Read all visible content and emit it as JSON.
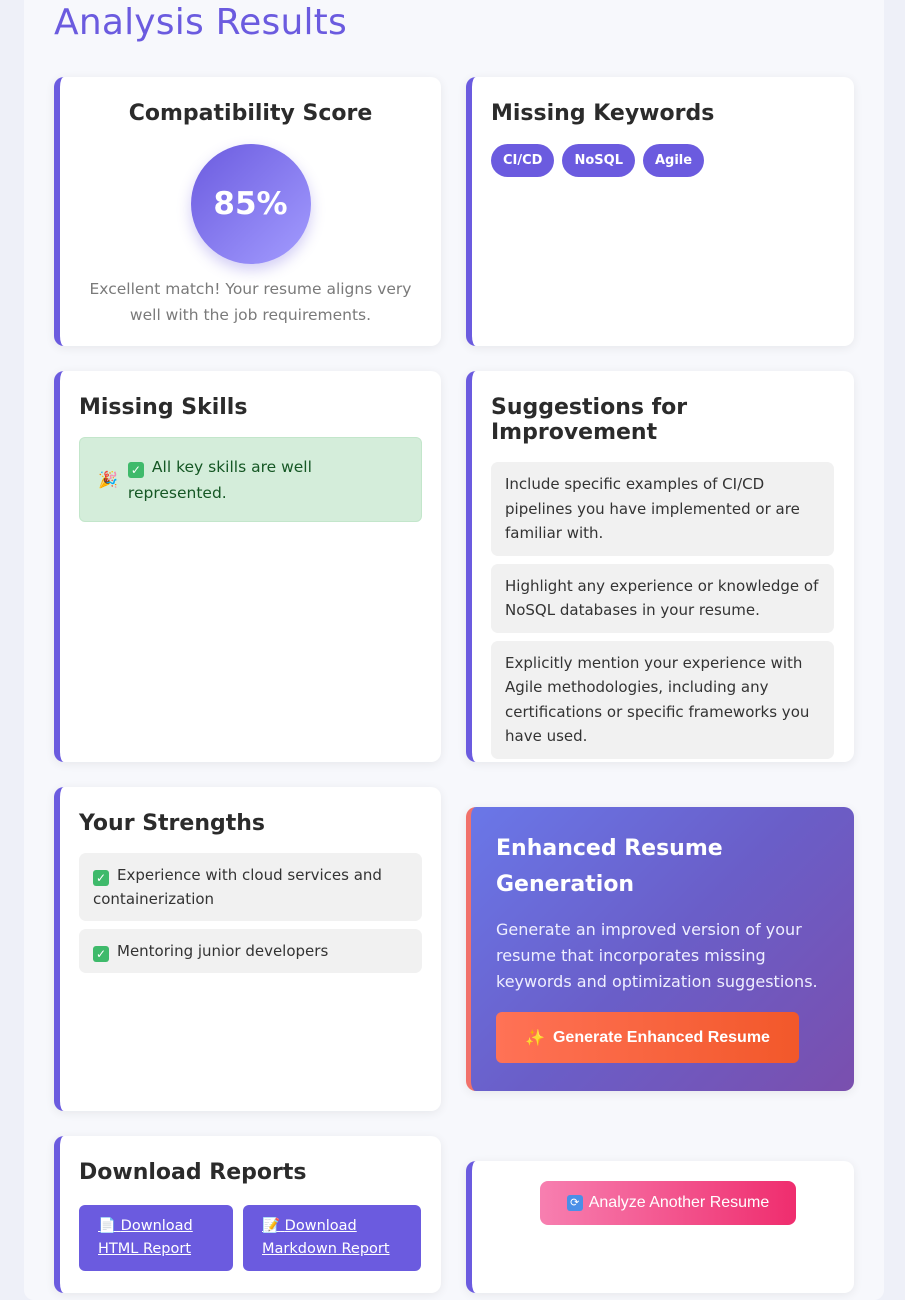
{
  "page": {
    "title": "Analysis Results"
  },
  "compatibility": {
    "heading": "Compatibility Score",
    "score": "85%",
    "description": "Excellent match! Your resume aligns very well with the job requirements."
  },
  "missing_keywords": {
    "heading": "Missing Keywords",
    "tags": [
      "CI/CD",
      "NoSQL",
      "Agile"
    ]
  },
  "missing_skills": {
    "heading": "Missing Skills",
    "message": "All key skills are well represented.",
    "icon": "party-popper-icon"
  },
  "suggestions": {
    "heading": "Suggestions for Improvement",
    "items": [
      "Include specific examples of CI/CD pipelines you have implemented or are familiar with.",
      "Highlight any experience or knowledge of NoSQL databases in your resume.",
      "Explicitly mention your experience with Agile methodologies, including any certifications or specific frameworks you have used."
    ]
  },
  "strengths": {
    "heading": "Your Strengths",
    "items": [
      "Experience with cloud services and containerization",
      "Mentoring junior developers"
    ]
  },
  "enhanced": {
    "heading": "Enhanced Resume Generation",
    "description": "Generate an improved version of your resume that incorporates missing keywords and optimization suggestions.",
    "button_label": "Generate Enhanced Resume",
    "button_icon": "sparkles-icon"
  },
  "download": {
    "heading": "Download Reports",
    "html_label": "Download HTML Report",
    "markdown_label": "Download Markdown Report"
  },
  "analyze": {
    "button_label": "Analyze Another Resume",
    "button_icon": "refresh-icon"
  },
  "colors": {
    "accent": "#6b5bdf",
    "success_bg": "#d4edda",
    "success_text": "#155724",
    "generate_button": "#f2582a",
    "analyze_button": "#ef2d6e"
  }
}
